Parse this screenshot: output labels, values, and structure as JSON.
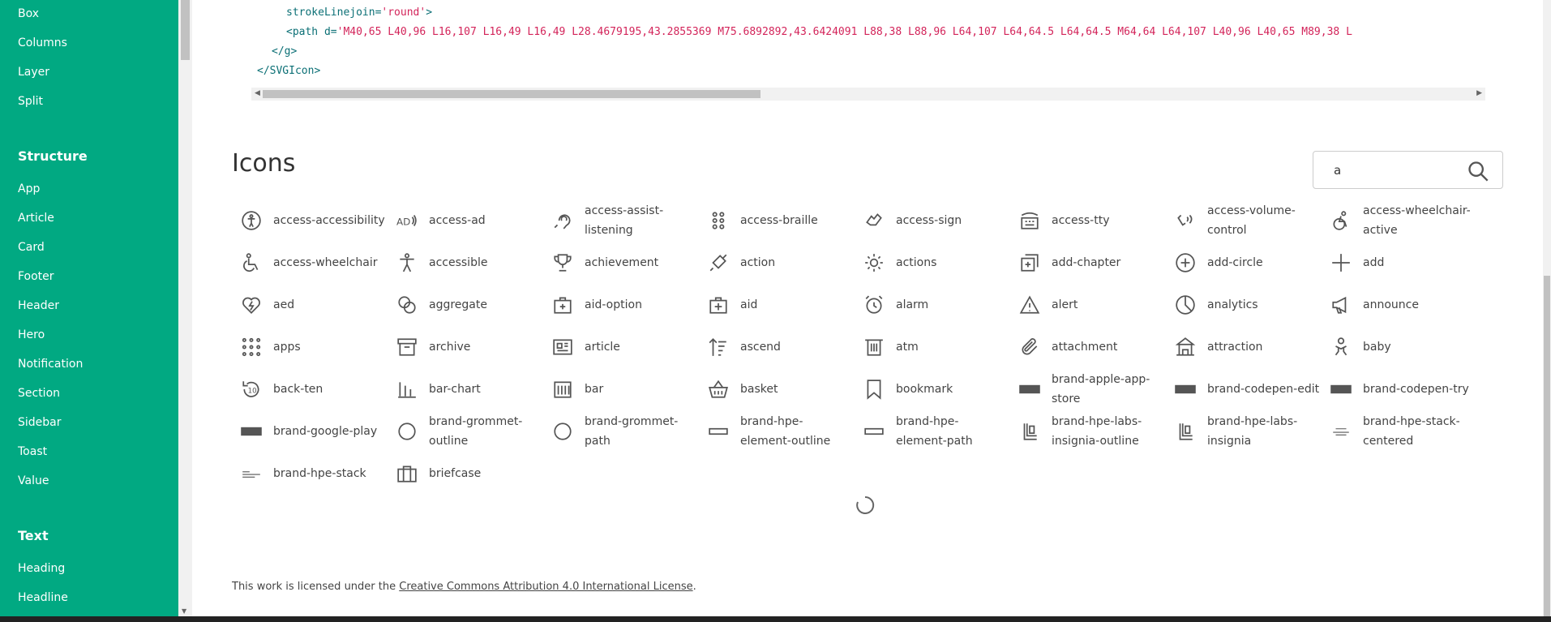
{
  "sidebar": {
    "items_top": [
      "Box",
      "Columns",
      "Layer",
      "Split"
    ],
    "section_structure": "Structure",
    "items_structure": [
      "App",
      "Article",
      "Card",
      "Footer",
      "Header",
      "Hero",
      "Notification",
      "Section",
      "Sidebar",
      "Toast",
      "Value"
    ],
    "section_text": "Text",
    "items_text": [
      "Heading",
      "Headline"
    ]
  },
  "code": {
    "line1_attr": "strokeLinejoin",
    "line1_val": "'round'",
    "line2_path_open": "<path d=",
    "line2_val": "'M40,65 L40,96 L16,107 L16,49 L16,49 L28.4679195,43.2855369 M75.6892892,43.6424091 L88,38 L88,96 L64,107 L64,64.5 L64,64.5 M64,64 L64,107 L40,96 L40,65 M89,38 L",
    "line3": "</g>",
    "line4": "</SVGIcon>"
  },
  "icons_section": {
    "title": "Icons",
    "search_value": "a"
  },
  "icons": [
    "access-accessibility",
    "access-ad",
    "access-assist-listening",
    "access-braille",
    "access-sign",
    "access-tty",
    "access-volume-control",
    "access-wheelchair-active",
    "access-wheelchair",
    "accessible",
    "achievement",
    "action",
    "actions",
    "add-chapter",
    "add-circle",
    "add",
    "aed",
    "aggregate",
    "aid-option",
    "aid",
    "alarm",
    "alert",
    "analytics",
    "announce",
    "apps",
    "archive",
    "article",
    "ascend",
    "atm",
    "attachment",
    "attraction",
    "baby",
    "back-ten",
    "bar-chart",
    "bar",
    "basket",
    "bookmark",
    "brand-apple-app-store",
    "brand-codepen-edit",
    "brand-codepen-try",
    "brand-google-play",
    "brand-grommet-outline",
    "brand-grommet-path",
    "brand-hpe-element-outline",
    "brand-hpe-element-path",
    "brand-hpe-labs-insignia-outline",
    "brand-hpe-labs-insignia",
    "brand-hpe-stack-centered",
    "brand-hpe-stack",
    "briefcase"
  ],
  "footer": {
    "license_prefix": "This work is licensed under the ",
    "license_link": "Creative Commons Attribution 4.0 International License",
    "license_suffix": "."
  },
  "colors": {
    "sidebar_bg": "#01a982",
    "code_tag": "#0b6f75",
    "code_string": "#d3245a"
  }
}
